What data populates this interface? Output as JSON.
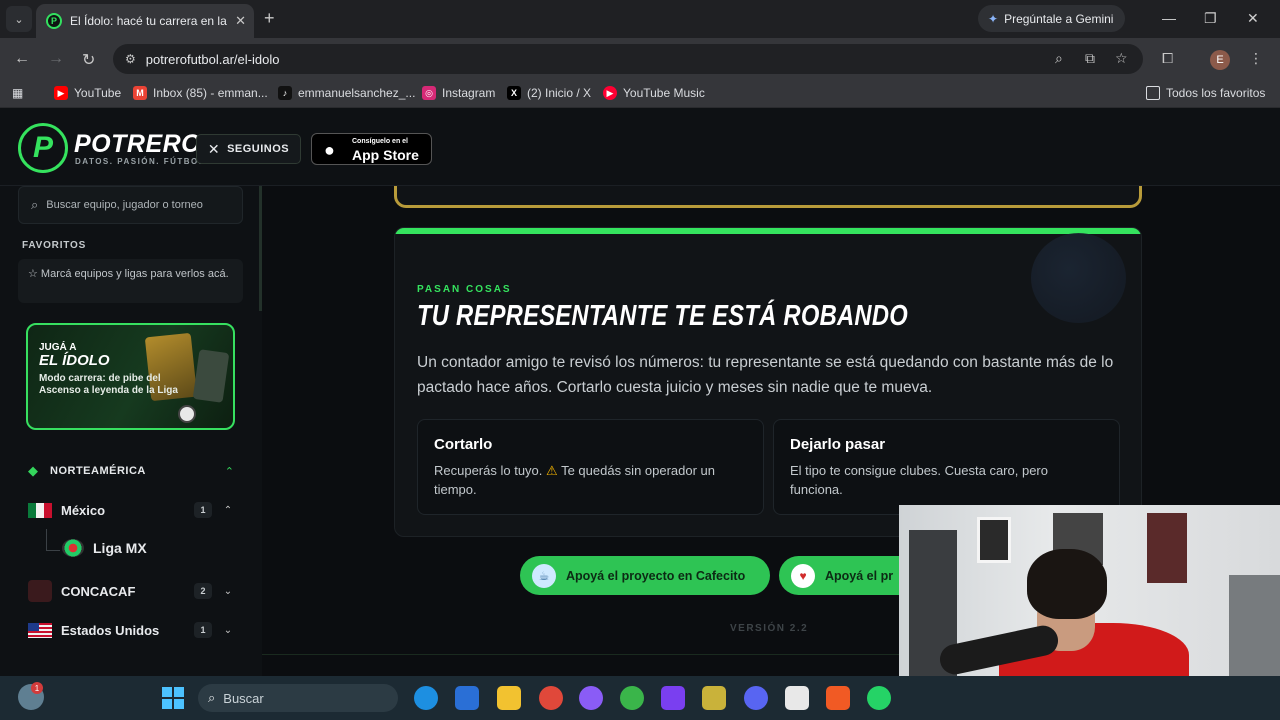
{
  "browser": {
    "tab_title": "El Ídolo: hacé tu carrera en la Liga",
    "url": "potrerofutbol.ar/el-idolo",
    "gemini_label": "Pregúntale a Gemini",
    "profile_initial": "E",
    "bookmarks": [
      {
        "label": "YouTube",
        "color": "#ff0000"
      },
      {
        "label": "Inbox (85) - emman...",
        "color": "#ea4335"
      },
      {
        "label": "emmanuelsanchez_...",
        "color": "#000000"
      },
      {
        "label": "Instagram",
        "color": "#d62976"
      },
      {
        "label": "(2) Inicio / X",
        "color": "#000000"
      },
      {
        "label": "YouTube Music",
        "color": "#ff0033"
      }
    ],
    "all_bookmarks": "Todos los favoritos"
  },
  "header": {
    "logo_letter": "P",
    "logo_name": "POTRERO",
    "logo_tagline": "DATOS. PASIÓN. FÚTBOL.",
    "follow_label": "SEGUINOS",
    "appstore_small": "Consíguelo en el",
    "appstore_big": "App Store"
  },
  "sidebar": {
    "search_placeholder": "Buscar equipo, jugador o torneo",
    "favorites_heading": "FAVORITOS",
    "favorites_empty": "Marcá equipos y ligas para verlos acá.",
    "promo": {
      "small": "JUGÁ A",
      "big": "EL ÍDOLO",
      "desc": "Modo carrera: de pibe del Ascenso a leyenda de la Liga"
    },
    "region": "NORTEAMÉRICA",
    "countries": [
      {
        "name": "México",
        "count": "1"
      },
      {
        "name": "CONCACAF",
        "count": "2"
      },
      {
        "name": "Estados Unidos",
        "count": "1"
      }
    ],
    "league": "Liga MX"
  },
  "event": {
    "kicker": "PASAN COSAS",
    "headline": "TU REPRESENTANTE TE ESTÁ ROBANDO",
    "body": "Un contador amigo te revisó los números: tu representante se está quedando con bastante más de lo pactado hace años. Cortarlo cuesta juicio y meses sin nadie que te mueva.",
    "options": [
      {
        "title": "Cortarlo",
        "desc_a": "Recuperás lo tuyo.",
        "warn": "⚠",
        "desc_b": "Te quedás sin operador un tiempo."
      },
      {
        "title": "Dejarlo pasar",
        "desc": "El tipo te consigue clubes. Cuesta caro, pero funciona."
      }
    ]
  },
  "support": {
    "cafecito": "Apoyá el proyecto en Cafecito",
    "second": "Apoyá el pr"
  },
  "version": "VERSIÓN 2.2",
  "taskbar": {
    "search_placeholder": "Buscar",
    "notif_count": "1"
  },
  "colors": {
    "accent": "#35e35e",
    "gold_border": "#b89b3a"
  }
}
